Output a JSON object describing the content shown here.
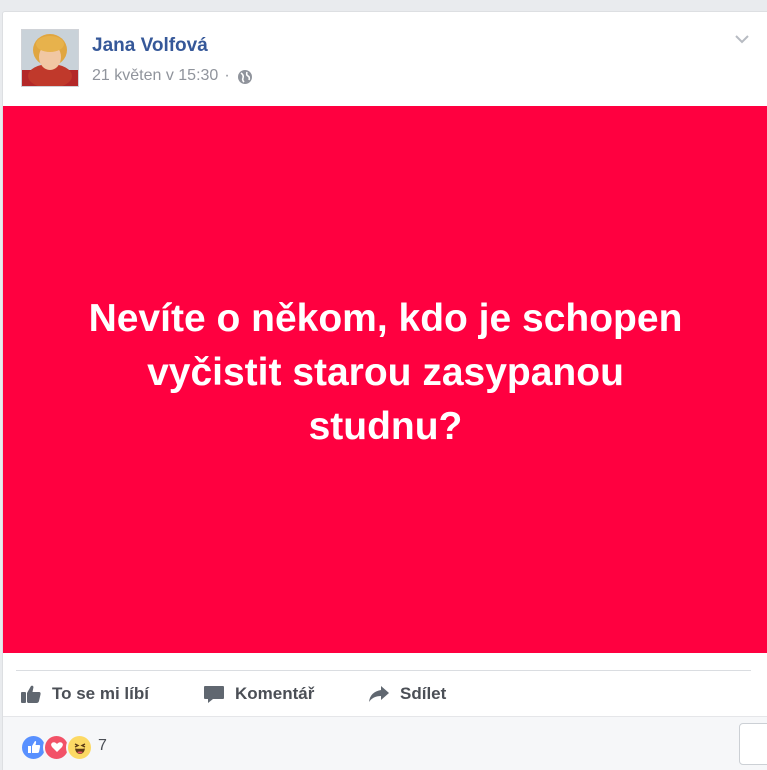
{
  "post": {
    "author": "Jana Volfová",
    "timestamp": "21 květen v 15:30",
    "separator": "·",
    "privacy_icon": "globe-icon",
    "options_icon": "chevron-down-icon",
    "image_text": "Nevíte o někom, kdo je schopen vyčistit starou zasypanou studnu?",
    "image_background": "#ff0040"
  },
  "actions": {
    "like_label": "To se mi líbí",
    "comment_label": "Komentář",
    "share_label": "Sdílet"
  },
  "reactions": {
    "icons": [
      "like-reaction-icon",
      "love-reaction-icon",
      "haha-reaction-icon"
    ],
    "count": "7"
  },
  "colors": {
    "link": "#365899",
    "secondary_text": "#90949c",
    "action_text": "#4b4f56",
    "like_blue": "#5890ff",
    "love_red": "#f25268",
    "haha_yellow": "#fcd964"
  }
}
